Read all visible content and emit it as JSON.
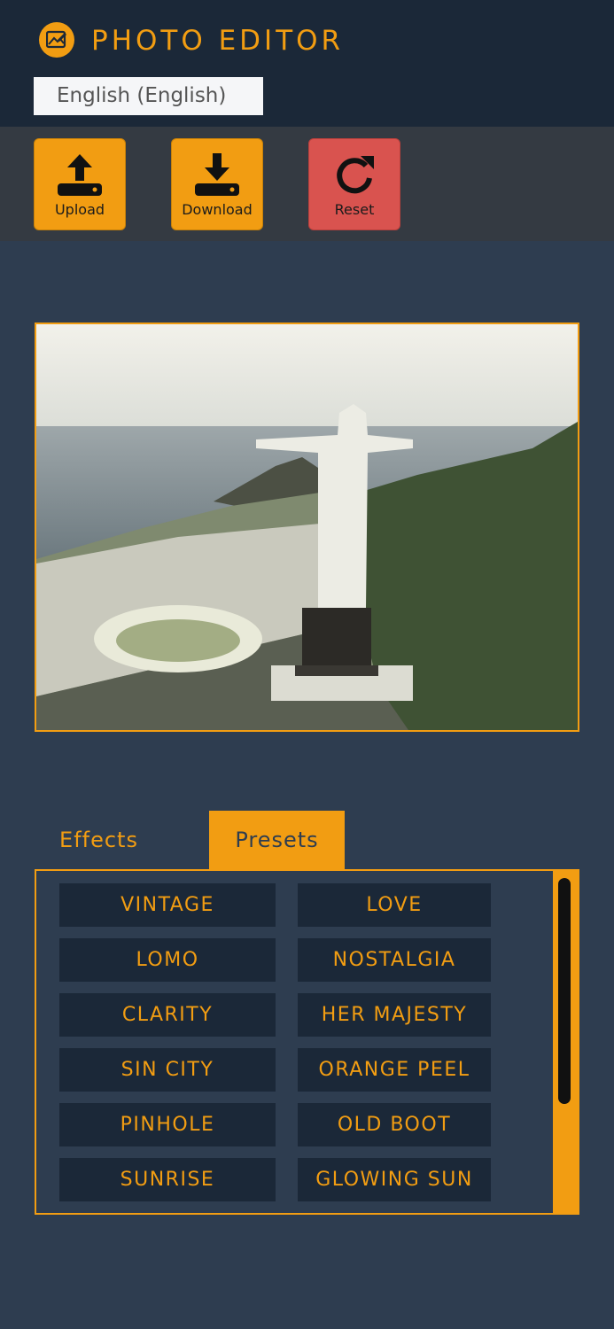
{
  "header": {
    "title": "PHOTO EDITOR",
    "logo_icon": "image-edit-icon",
    "language": "English (English)"
  },
  "toolbar": {
    "upload_label": "Upload",
    "download_label": "Download",
    "reset_label": "Reset"
  },
  "canvas": {
    "image_alt": "Christ the Redeemer statue overlooking Rio de Janeiro"
  },
  "tabs": {
    "effects": "Effects",
    "presets": "Presets",
    "active": "Presets"
  },
  "presets": [
    "VINTAGE",
    "LOVE",
    "LOMO",
    "NOSTALGIA",
    "CLARITY",
    "HER MAJESTY",
    "SIN CITY",
    "ORANGE PEEL",
    "PINHOLE",
    "OLD BOOT",
    "SUNRISE",
    "GLOWING SUN"
  ],
  "colors": {
    "accent": "#f29d12",
    "header_bg": "#1b2838",
    "page_bg": "#2e3d50",
    "toolbar_bg": "#343a42",
    "reset": "#d9534f"
  }
}
